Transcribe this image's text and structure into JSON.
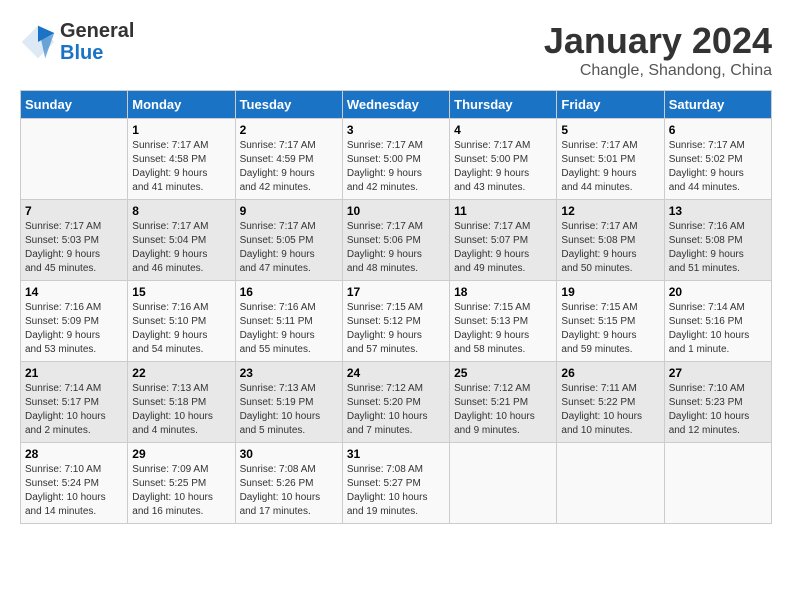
{
  "logo": {
    "general": "General",
    "blue": "Blue"
  },
  "title": "January 2024",
  "subtitle": "Changle, Shandong, China",
  "days_header": [
    "Sunday",
    "Monday",
    "Tuesday",
    "Wednesday",
    "Thursday",
    "Friday",
    "Saturday"
  ],
  "weeks": [
    [
      {
        "day": "",
        "info": ""
      },
      {
        "day": "1",
        "info": "Sunrise: 7:17 AM\nSunset: 4:58 PM\nDaylight: 9 hours\nand 41 minutes."
      },
      {
        "day": "2",
        "info": "Sunrise: 7:17 AM\nSunset: 4:59 PM\nDaylight: 9 hours\nand 42 minutes."
      },
      {
        "day": "3",
        "info": "Sunrise: 7:17 AM\nSunset: 5:00 PM\nDaylight: 9 hours\nand 42 minutes."
      },
      {
        "day": "4",
        "info": "Sunrise: 7:17 AM\nSunset: 5:00 PM\nDaylight: 9 hours\nand 43 minutes."
      },
      {
        "day": "5",
        "info": "Sunrise: 7:17 AM\nSunset: 5:01 PM\nDaylight: 9 hours\nand 44 minutes."
      },
      {
        "day": "6",
        "info": "Sunrise: 7:17 AM\nSunset: 5:02 PM\nDaylight: 9 hours\nand 44 minutes."
      }
    ],
    [
      {
        "day": "7",
        "info": "Sunrise: 7:17 AM\nSunset: 5:03 PM\nDaylight: 9 hours\nand 45 minutes."
      },
      {
        "day": "8",
        "info": "Sunrise: 7:17 AM\nSunset: 5:04 PM\nDaylight: 9 hours\nand 46 minutes."
      },
      {
        "day": "9",
        "info": "Sunrise: 7:17 AM\nSunset: 5:05 PM\nDaylight: 9 hours\nand 47 minutes."
      },
      {
        "day": "10",
        "info": "Sunrise: 7:17 AM\nSunset: 5:06 PM\nDaylight: 9 hours\nand 48 minutes."
      },
      {
        "day": "11",
        "info": "Sunrise: 7:17 AM\nSunset: 5:07 PM\nDaylight: 9 hours\nand 49 minutes."
      },
      {
        "day": "12",
        "info": "Sunrise: 7:17 AM\nSunset: 5:08 PM\nDaylight: 9 hours\nand 50 minutes."
      },
      {
        "day": "13",
        "info": "Sunrise: 7:16 AM\nSunset: 5:08 PM\nDaylight: 9 hours\nand 51 minutes."
      }
    ],
    [
      {
        "day": "14",
        "info": "Sunrise: 7:16 AM\nSunset: 5:09 PM\nDaylight: 9 hours\nand 53 minutes."
      },
      {
        "day": "15",
        "info": "Sunrise: 7:16 AM\nSunset: 5:10 PM\nDaylight: 9 hours\nand 54 minutes."
      },
      {
        "day": "16",
        "info": "Sunrise: 7:16 AM\nSunset: 5:11 PM\nDaylight: 9 hours\nand 55 minutes."
      },
      {
        "day": "17",
        "info": "Sunrise: 7:15 AM\nSunset: 5:12 PM\nDaylight: 9 hours\nand 57 minutes."
      },
      {
        "day": "18",
        "info": "Sunrise: 7:15 AM\nSunset: 5:13 PM\nDaylight: 9 hours\nand 58 minutes."
      },
      {
        "day": "19",
        "info": "Sunrise: 7:15 AM\nSunset: 5:15 PM\nDaylight: 9 hours\nand 59 minutes."
      },
      {
        "day": "20",
        "info": "Sunrise: 7:14 AM\nSunset: 5:16 PM\nDaylight: 10 hours\nand 1 minute."
      }
    ],
    [
      {
        "day": "21",
        "info": "Sunrise: 7:14 AM\nSunset: 5:17 PM\nDaylight: 10 hours\nand 2 minutes."
      },
      {
        "day": "22",
        "info": "Sunrise: 7:13 AM\nSunset: 5:18 PM\nDaylight: 10 hours\nand 4 minutes."
      },
      {
        "day": "23",
        "info": "Sunrise: 7:13 AM\nSunset: 5:19 PM\nDaylight: 10 hours\nand 5 minutes."
      },
      {
        "day": "24",
        "info": "Sunrise: 7:12 AM\nSunset: 5:20 PM\nDaylight: 10 hours\nand 7 minutes."
      },
      {
        "day": "25",
        "info": "Sunrise: 7:12 AM\nSunset: 5:21 PM\nDaylight: 10 hours\nand 9 minutes."
      },
      {
        "day": "26",
        "info": "Sunrise: 7:11 AM\nSunset: 5:22 PM\nDaylight: 10 hours\nand 10 minutes."
      },
      {
        "day": "27",
        "info": "Sunrise: 7:10 AM\nSunset: 5:23 PM\nDaylight: 10 hours\nand 12 minutes."
      }
    ],
    [
      {
        "day": "28",
        "info": "Sunrise: 7:10 AM\nSunset: 5:24 PM\nDaylight: 10 hours\nand 14 minutes."
      },
      {
        "day": "29",
        "info": "Sunrise: 7:09 AM\nSunset: 5:25 PM\nDaylight: 10 hours\nand 16 minutes."
      },
      {
        "day": "30",
        "info": "Sunrise: 7:08 AM\nSunset: 5:26 PM\nDaylight: 10 hours\nand 17 minutes."
      },
      {
        "day": "31",
        "info": "Sunrise: 7:08 AM\nSunset: 5:27 PM\nDaylight: 10 hours\nand 19 minutes."
      },
      {
        "day": "",
        "info": ""
      },
      {
        "day": "",
        "info": ""
      },
      {
        "day": "",
        "info": ""
      }
    ]
  ]
}
